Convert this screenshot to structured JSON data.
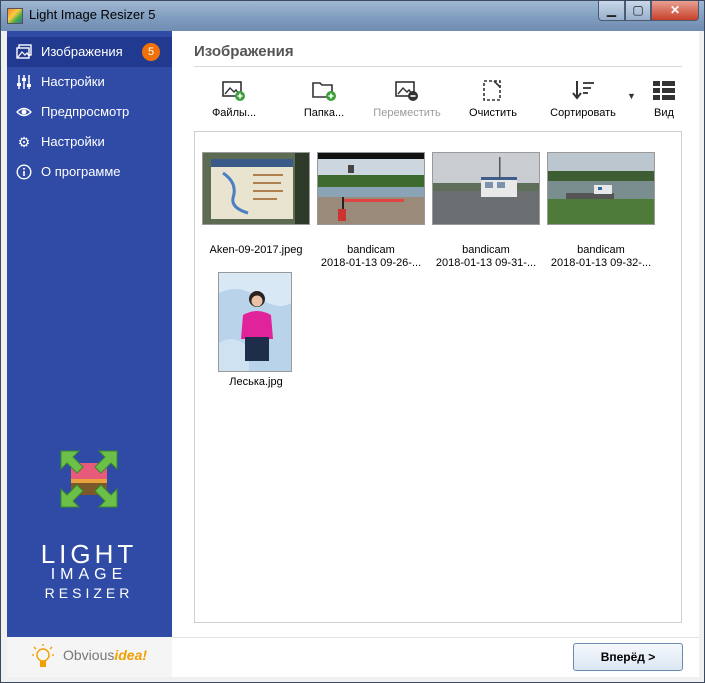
{
  "window": {
    "title": "Light Image Resizer 5"
  },
  "window_controls": {
    "minimize": "▁",
    "maximize": "▢",
    "close": "✕"
  },
  "sidebar": {
    "items": [
      {
        "label": "Изображения",
        "icon": "images-icon",
        "badge": "5",
        "active": true
      },
      {
        "label": "Настройки",
        "icon": "sliders-icon"
      },
      {
        "label": "Предпросмотр",
        "icon": "eye-icon"
      },
      {
        "label": "Настройки",
        "icon": "gear-icon"
      },
      {
        "label": "О программе",
        "icon": "info-icon"
      }
    ],
    "logo": {
      "line1": "LIGHT",
      "line2": "IMAGE",
      "line3": "RESIZER"
    },
    "brand": {
      "prefix": "Obvious",
      "suffix": "idea!"
    }
  },
  "main": {
    "title": "Изображения",
    "toolbar": {
      "files": "Файлы...",
      "folder": "Папка...",
      "move": "Переместить",
      "clear": "Очистить",
      "sort": "Сортировать",
      "view": "Вид"
    },
    "thumbnails": [
      {
        "line1": "Aken-09-2017.jpeg",
        "line2": ""
      },
      {
        "line1": "bandicam",
        "line2": "2018-01-13 09-26-..."
      },
      {
        "line1": "bandicam",
        "line2": "2018-01-13 09-31-..."
      },
      {
        "line1": "bandicam",
        "line2": "2018-01-13 09-32-..."
      },
      {
        "line1": "Леська.jpg",
        "line2": ""
      }
    ]
  },
  "footer": {
    "next": "Вперёд >"
  },
  "colors": {
    "sidebar": "#2f4ba6",
    "sidebar_active": "#213a8f",
    "badge": "#f0700a",
    "accent_green": "#3aa13a"
  }
}
